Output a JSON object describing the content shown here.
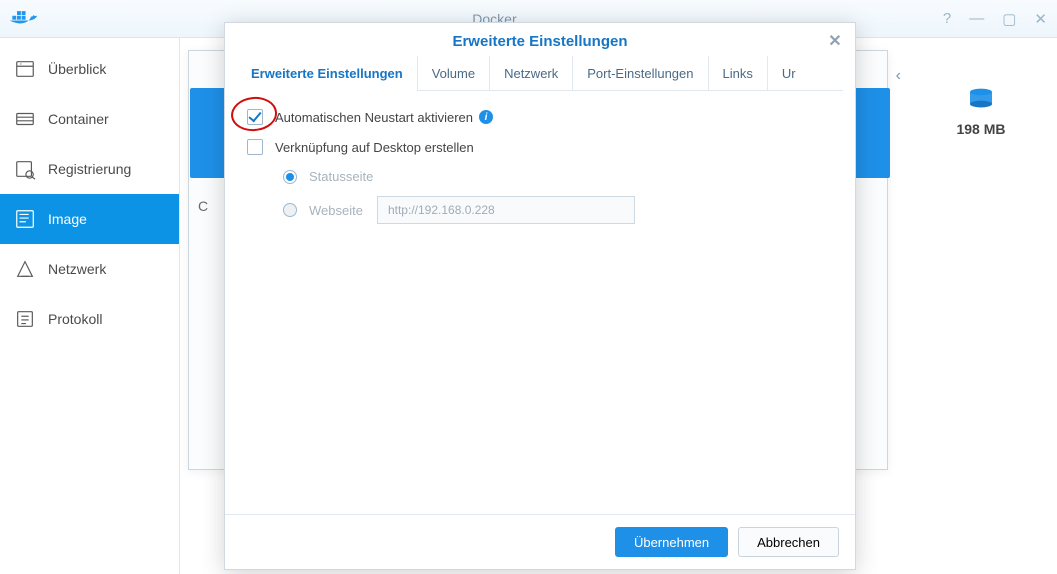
{
  "window": {
    "title": "Docker",
    "help": "?",
    "minimize": "—",
    "maximize": "▢",
    "close": "✕"
  },
  "sidebar": {
    "items": [
      {
        "label": "Überblick"
      },
      {
        "label": "Container"
      },
      {
        "label": "Registrierung"
      },
      {
        "label": "Image"
      },
      {
        "label": "Netzwerk"
      },
      {
        "label": "Protokoll"
      }
    ],
    "active_index": 3
  },
  "main": {
    "crumb_left": "C",
    "storage": "198 MB"
  },
  "modal": {
    "title": "Erweiterte Einstellungen",
    "tabs": [
      {
        "label": "Erweiterte Einstellungen",
        "active": true
      },
      {
        "label": "Volume"
      },
      {
        "label": "Netzwerk"
      },
      {
        "label": "Port-Einstellungen"
      },
      {
        "label": "Links"
      },
      {
        "label": "Ur"
      }
    ],
    "auto_restart": {
      "checked": true,
      "label": "Automatischen Neustart aktivieren"
    },
    "desktop_shortcut": {
      "checked": false,
      "label": "Verknüpfung auf Desktop erstellen"
    },
    "radio": {
      "status": "Statusseite",
      "website": "Webseite",
      "selected": "status",
      "website_url": "http://192.168.0.228"
    },
    "buttons": {
      "apply": "Übernehmen",
      "cancel": "Abbrechen"
    }
  }
}
